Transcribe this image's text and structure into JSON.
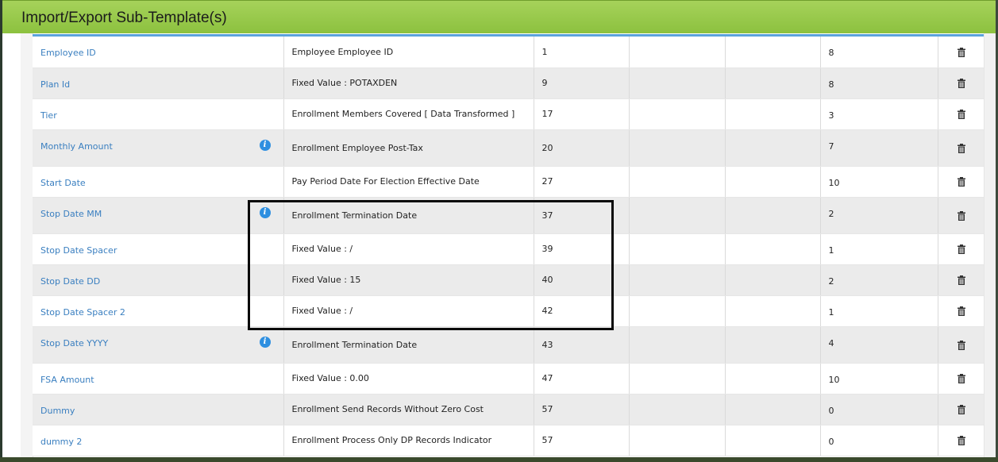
{
  "panel": {
    "title": "Import/Export Sub-Template(s)"
  },
  "rows": [
    {
      "field": "Employee ID",
      "info": false,
      "source": "Employee Employee ID",
      "position": "1",
      "size": "8"
    },
    {
      "field": "Plan Id",
      "info": false,
      "source": "Fixed Value : POTAXDEN",
      "position": "9",
      "size": "8"
    },
    {
      "field": "Tier",
      "info": false,
      "source": "Enrollment Members Covered [ Data Transformed ]",
      "position": "17",
      "size": "3"
    },
    {
      "field": "Monthly Amount",
      "info": true,
      "source": "Enrollment Employee Post-Tax",
      "position": "20",
      "size": "7"
    },
    {
      "field": "Start Date",
      "info": false,
      "source": "Pay Period Date For Election Effective Date",
      "position": "27",
      "size": "10"
    },
    {
      "field": "Stop Date MM",
      "info": true,
      "source": "Enrollment Termination Date",
      "position": "37",
      "size": "2"
    },
    {
      "field": "Stop Date Spacer",
      "info": false,
      "source": "Fixed Value : /",
      "position": "39",
      "size": "1"
    },
    {
      "field": "Stop Date DD",
      "info": false,
      "source": "Fixed Value : 15",
      "position": "40",
      "size": "2"
    },
    {
      "field": "Stop Date Spacer 2",
      "info": false,
      "source": "Fixed Value : /",
      "position": "42",
      "size": "1"
    },
    {
      "field": "Stop Date YYYY",
      "info": true,
      "source": "Enrollment Termination Date",
      "position": "43",
      "size": "4"
    },
    {
      "field": "FSA Amount",
      "info": false,
      "source": "Fixed Value : 0.00",
      "position": "47",
      "size": "10"
    },
    {
      "field": "Dummy",
      "info": false,
      "source": "Enrollment Send Records Without Zero Cost",
      "position": "57",
      "size": "0"
    },
    {
      "field": "dummy 2",
      "info": false,
      "source": "Enrollment Process Only DP Records Indicator",
      "position": "57",
      "size": "0"
    }
  ],
  "icons": {
    "info": "i",
    "delete": "trash-icon"
  },
  "colors": {
    "header_green": "#8cc13f",
    "link_blue": "#3a7fc0",
    "accent_rule": "#5aa3dc",
    "info_blue": "#2e8fe0"
  }
}
